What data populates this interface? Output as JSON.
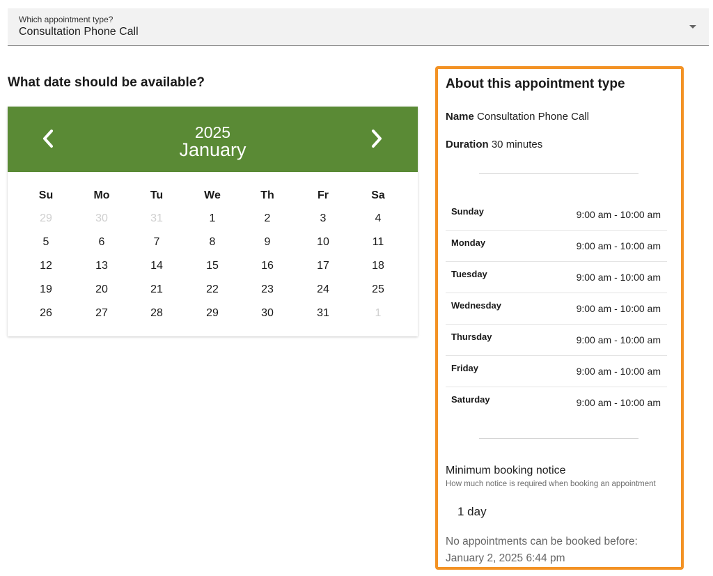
{
  "appointment_select": {
    "label": "Which appointment type?",
    "value": "Consultation Phone Call"
  },
  "date_heading": "What date should be available?",
  "calendar": {
    "year": "2025",
    "month": "January",
    "weekdays": [
      "Su",
      "Mo",
      "Tu",
      "We",
      "Th",
      "Fr",
      "Sa"
    ],
    "weeks": [
      [
        {
          "d": "29",
          "muted": true
        },
        {
          "d": "30",
          "muted": true
        },
        {
          "d": "31",
          "muted": true
        },
        {
          "d": "1"
        },
        {
          "d": "2"
        },
        {
          "d": "3"
        },
        {
          "d": "4"
        }
      ],
      [
        {
          "d": "5"
        },
        {
          "d": "6"
        },
        {
          "d": "7"
        },
        {
          "d": "8"
        },
        {
          "d": "9"
        },
        {
          "d": "10"
        },
        {
          "d": "11"
        }
      ],
      [
        {
          "d": "12"
        },
        {
          "d": "13"
        },
        {
          "d": "14"
        },
        {
          "d": "15"
        },
        {
          "d": "16"
        },
        {
          "d": "17"
        },
        {
          "d": "18"
        }
      ],
      [
        {
          "d": "19"
        },
        {
          "d": "20"
        },
        {
          "d": "21"
        },
        {
          "d": "22"
        },
        {
          "d": "23"
        },
        {
          "d": "24"
        },
        {
          "d": "25"
        }
      ],
      [
        {
          "d": "26"
        },
        {
          "d": "27"
        },
        {
          "d": "28"
        },
        {
          "d": "29"
        },
        {
          "d": "30"
        },
        {
          "d": "31"
        },
        {
          "d": "1",
          "muted": true
        }
      ]
    ],
    "header_color": "#5a8a35",
    "prev_icon": "chevron-left-icon",
    "next_icon": "chevron-right-icon"
  },
  "info": {
    "title": "About this appointment type",
    "name_label": "Name",
    "name_value": "Consultation Phone Call",
    "duration_label": "Duration",
    "duration_value": "30 minutes",
    "hours": [
      {
        "day": "Sunday",
        "time": "9:00 am - 10:00 am"
      },
      {
        "day": "Monday",
        "time": "9:00 am - 10:00 am"
      },
      {
        "day": "Tuesday",
        "time": "9:00 am - 10:00 am"
      },
      {
        "day": "Wednesday",
        "time": "9:00 am - 10:00 am"
      },
      {
        "day": "Thursday",
        "time": "9:00 am - 10:00 am"
      },
      {
        "day": "Friday",
        "time": "9:00 am - 10:00 am"
      },
      {
        "day": "Saturday",
        "time": "9:00 am - 10:00 am"
      }
    ],
    "min_notice_title": "Minimum booking notice",
    "min_notice_sub": "How much notice is required when booking an appointment",
    "min_notice_value": "1 day",
    "no_appointments_text": "No appointments can be booked before:",
    "no_appointments_date": "January 2, 2025 6:44 pm",
    "border_color": "#f39224"
  }
}
